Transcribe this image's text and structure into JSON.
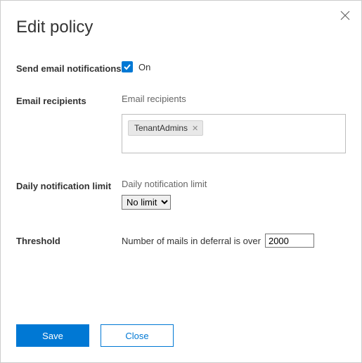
{
  "title": "Edit policy",
  "sections": {
    "notifications": {
      "label": "Send email notifications",
      "checked": true,
      "state_text": "On"
    },
    "recipients": {
      "label": "Email recipients",
      "sublabel": "Email recipients",
      "chip": "TenantAdmins"
    },
    "daily_limit": {
      "label": "Daily notification limit",
      "sublabel": "Daily notification limit",
      "selected": "No limit"
    },
    "threshold": {
      "label": "Threshold",
      "text": "Number of mails in deferral is over",
      "value": "2000"
    }
  },
  "buttons": {
    "save": "Save",
    "close": "Close"
  }
}
